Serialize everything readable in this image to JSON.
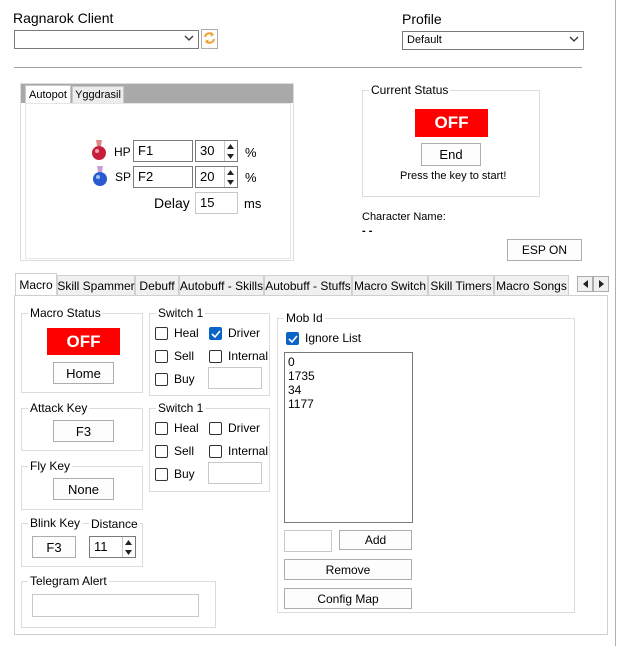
{
  "header": {
    "client_label": "Ragnarok Client",
    "client_value": "",
    "profile_label": "Profile",
    "profile_value": "Default"
  },
  "autopot": {
    "tabs": [
      "Autopot",
      "Yggdrasil"
    ],
    "hp_label": "HP",
    "hp_key": "F1",
    "hp_percent": "30",
    "sp_label": "SP",
    "sp_key": "F2",
    "sp_percent": "20",
    "percent_unit": "%",
    "delay_label": "Delay",
    "delay_value": "15",
    "delay_unit": "ms"
  },
  "status": {
    "title": "Current Status",
    "state": "OFF",
    "end_button": "End",
    "hint": "Press the key to start!",
    "character_name_label": "Character Name:",
    "character_name_value": "- -",
    "esp_button": "ESP ON"
  },
  "main_tabs": [
    "Macro",
    "Skill Spammer",
    "Debuff",
    "Autobuff - Skills",
    "Autobuff - Stuffs",
    "Macro Switch",
    "Skill Timers",
    "Macro Songs"
  ],
  "macro": {
    "status_title": "Macro Status",
    "status_state": "OFF",
    "home_button": "Home",
    "attack_key_title": "Attack Key",
    "attack_key_value": "F3",
    "fly_key_title": "Fly Key",
    "fly_key_value": "None",
    "blink_key_title": "Blink Key",
    "blink_key_value": "F3",
    "distance_title": "Distance",
    "distance_value": "11",
    "telegram_title": "Telegram Alert",
    "telegram_value": ""
  },
  "switch1": {
    "title": "Switch 1",
    "heal": "Heal",
    "driver": "Driver",
    "sell": "Sell",
    "internal": "Internal",
    "buy": "Buy",
    "heal_checked": false,
    "driver_checked": true,
    "sell_checked": false,
    "internal_checked": false,
    "buy_checked": false
  },
  "switch2": {
    "title": "Switch 1",
    "heal": "Heal",
    "driver": "Driver",
    "sell": "Sell",
    "internal": "Internal",
    "buy": "Buy"
  },
  "mob": {
    "title": "Mob Id",
    "ignore_label": "Ignore List",
    "ignore_checked": true,
    "ids": [
      "0",
      "1735",
      "34",
      "1177"
    ],
    "add_button": "Add",
    "remove_button": "Remove",
    "config_button": "Config Map"
  },
  "colors": {
    "off_red": "#ff0000",
    "check_blue": "#0a64c8",
    "refresh_orange": "#f0a030"
  }
}
